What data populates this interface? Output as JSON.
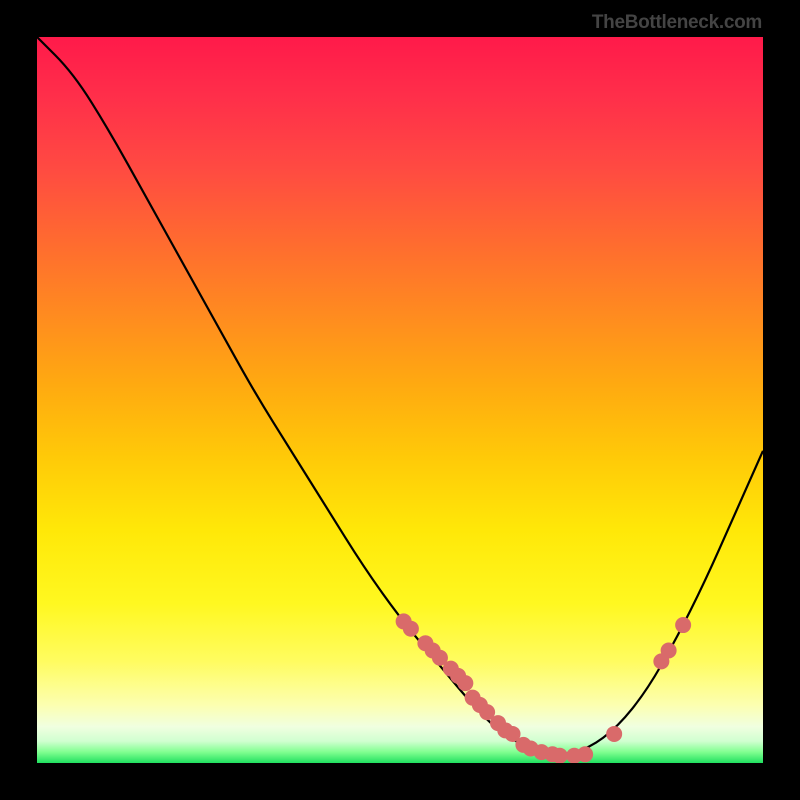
{
  "brand": "TheBottleneck.com",
  "chart_data": {
    "type": "line",
    "title": "",
    "xlabel": "",
    "ylabel": "",
    "xlim": [
      0,
      1
    ],
    "ylim": [
      0,
      1
    ],
    "series": [
      {
        "name": "curve",
        "x": [
          0.0,
          0.05,
          0.1,
          0.15,
          0.2,
          0.25,
          0.3,
          0.35,
          0.4,
          0.45,
          0.5,
          0.55,
          0.6,
          0.64,
          0.68,
          0.72,
          0.76,
          0.8,
          0.84,
          0.88,
          0.92,
          0.96,
          1.0
        ],
        "values": [
          1.0,
          0.95,
          0.87,
          0.78,
          0.69,
          0.6,
          0.51,
          0.43,
          0.35,
          0.27,
          0.2,
          0.14,
          0.08,
          0.04,
          0.02,
          0.01,
          0.02,
          0.05,
          0.1,
          0.17,
          0.25,
          0.34,
          0.43
        ]
      }
    ],
    "markers": {
      "x": [
        0.505,
        0.515,
        0.535,
        0.545,
        0.555,
        0.57,
        0.58,
        0.59,
        0.6,
        0.61,
        0.62,
        0.635,
        0.645,
        0.655,
        0.67,
        0.68,
        0.695,
        0.71,
        0.72,
        0.74,
        0.755,
        0.795,
        0.86,
        0.87,
        0.89
      ],
      "y": [
        0.195,
        0.185,
        0.165,
        0.155,
        0.145,
        0.13,
        0.12,
        0.11,
        0.09,
        0.08,
        0.07,
        0.055,
        0.045,
        0.04,
        0.025,
        0.02,
        0.015,
        0.012,
        0.01,
        0.01,
        0.012,
        0.04,
        0.14,
        0.155,
        0.19
      ],
      "color": "#d96a6a",
      "radius": 8
    },
    "colors": {
      "line": "#000000"
    }
  }
}
